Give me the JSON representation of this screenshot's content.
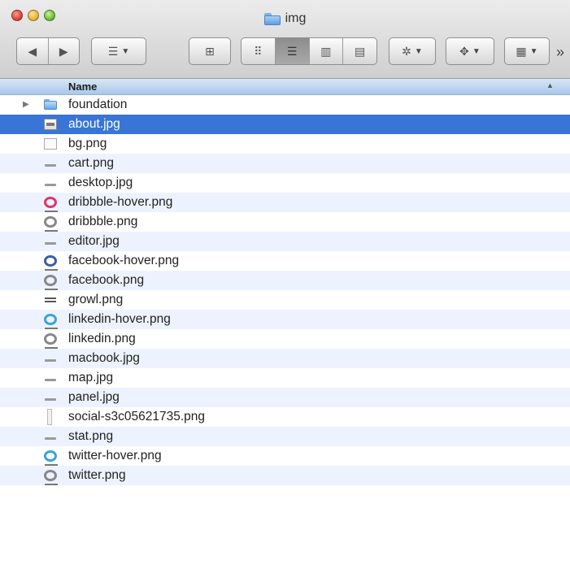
{
  "window": {
    "title": "img",
    "traffic_lights": [
      "close",
      "minimize",
      "zoom"
    ]
  },
  "toolbar": {
    "nav": [
      "◀",
      "▶"
    ],
    "overflow": "»"
  },
  "list": {
    "column_header": "Name",
    "sort_indicator": "▲",
    "rows": [
      {
        "name": "foundation",
        "icon": "folder-icon",
        "expandable": true,
        "selected": false
      },
      {
        "name": "about.jpg",
        "icon": "image-file-icon",
        "expandable": false,
        "selected": true
      },
      {
        "name": "bg.png",
        "icon": "blank-image-icon",
        "expandable": false,
        "selected": false
      },
      {
        "name": "cart.png",
        "icon": "bar-image-icon",
        "expandable": false,
        "selected": false
      },
      {
        "name": "desktop.jpg",
        "icon": "bar-image-icon",
        "expandable": false,
        "selected": false
      },
      {
        "name": "dribbble-hover.png",
        "icon": "dribbble-hover-icon",
        "expandable": false,
        "selected": false
      },
      {
        "name": "dribbble.png",
        "icon": "dribbble-icon",
        "expandable": false,
        "selected": false
      },
      {
        "name": "editor.jpg",
        "icon": "bar-image-icon",
        "expandable": false,
        "selected": false
      },
      {
        "name": "facebook-hover.png",
        "icon": "facebook-hover-icon",
        "expandable": false,
        "selected": false
      },
      {
        "name": "facebook.png",
        "icon": "facebook-icon",
        "expandable": false,
        "selected": false
      },
      {
        "name": "growl.png",
        "icon": "lines-image-icon",
        "expandable": false,
        "selected": false
      },
      {
        "name": "linkedin-hover.png",
        "icon": "linkedin-hover-icon",
        "expandable": false,
        "selected": false
      },
      {
        "name": "linkedin.png",
        "icon": "linkedin-icon",
        "expandable": false,
        "selected": false
      },
      {
        "name": "macbook.jpg",
        "icon": "bar-image-icon",
        "expandable": false,
        "selected": false
      },
      {
        "name": "map.jpg",
        "icon": "bar-image-icon",
        "expandable": false,
        "selected": false
      },
      {
        "name": "panel.jpg",
        "icon": "bar-image-icon",
        "expandable": false,
        "selected": false
      },
      {
        "name": "social-s3c05621735.png",
        "icon": "sprite-image-icon",
        "expandable": false,
        "selected": false
      },
      {
        "name": "stat.png",
        "icon": "bar-image-icon",
        "expandable": false,
        "selected": false
      },
      {
        "name": "twitter-hover.png",
        "icon": "twitter-hover-icon",
        "expandable": false,
        "selected": false
      },
      {
        "name": "twitter.png",
        "icon": "twitter-icon",
        "expandable": false,
        "selected": false
      }
    ]
  }
}
